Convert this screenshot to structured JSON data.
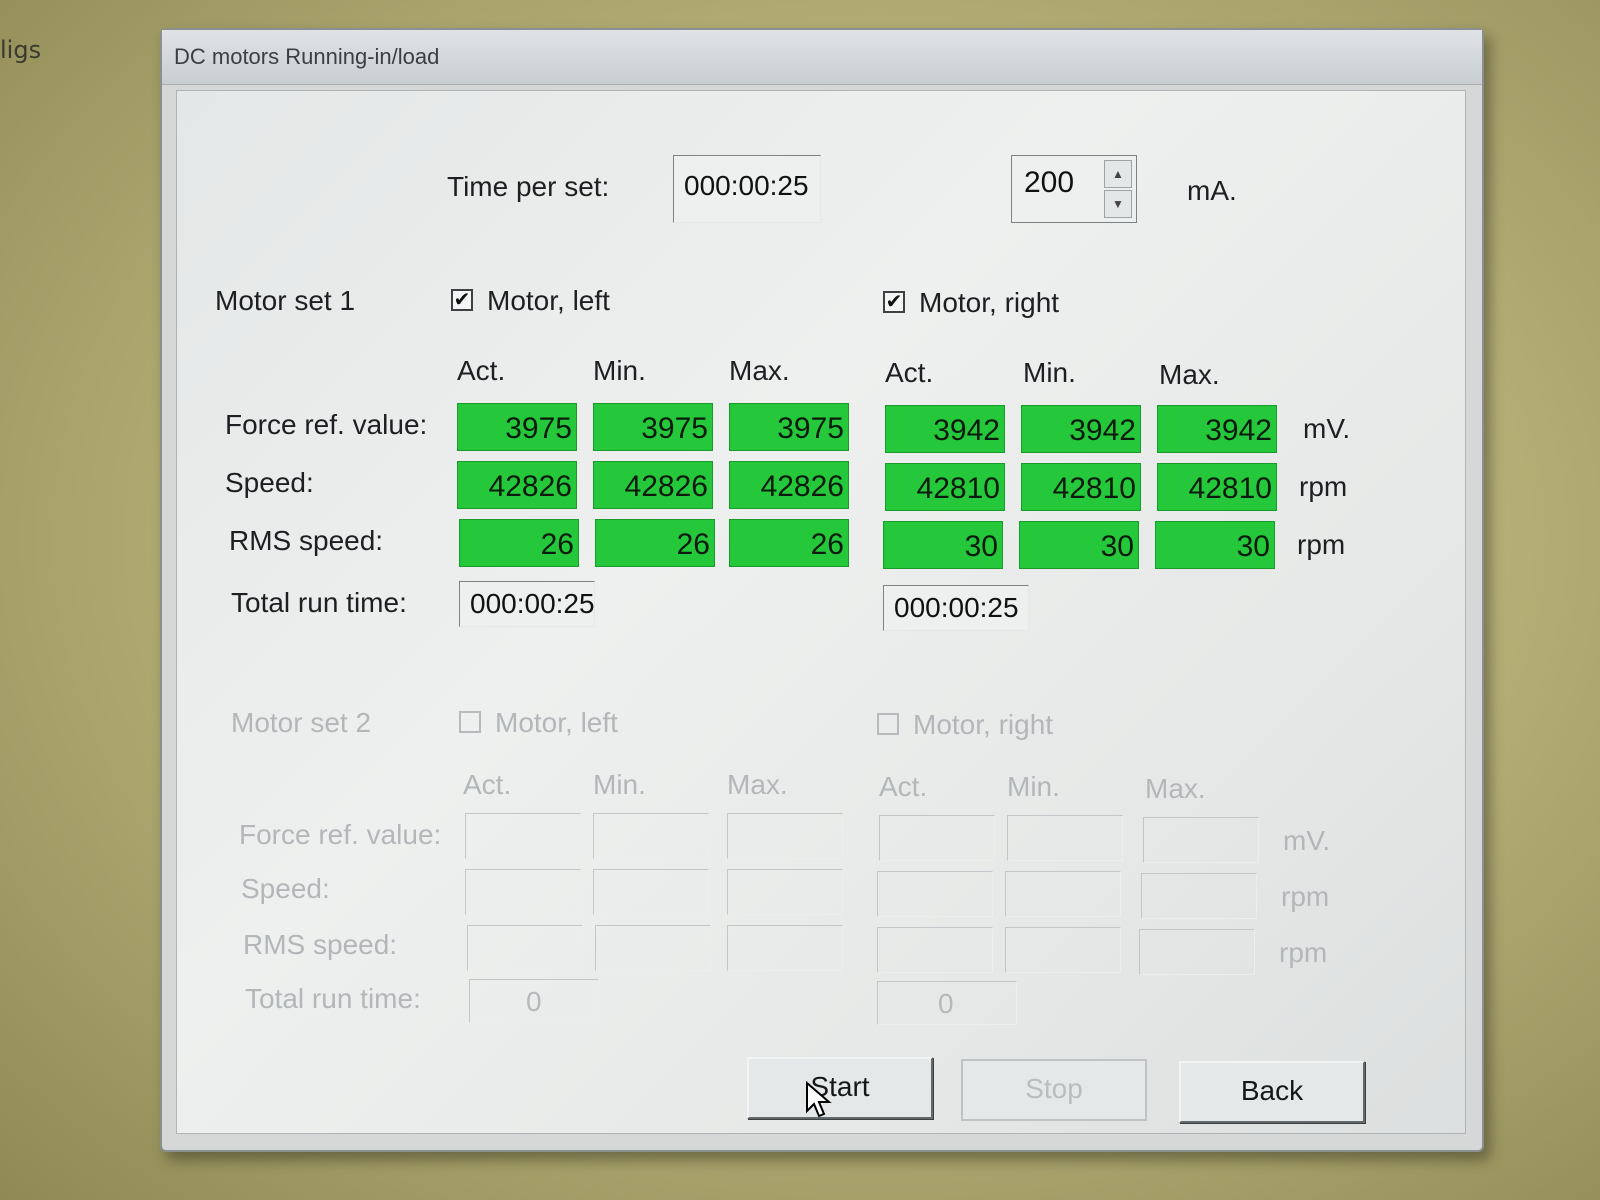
{
  "background": {
    "edge_text": "ligs"
  },
  "window": {
    "title": "DC motors Running-in/load"
  },
  "top": {
    "time_per_set_label": "Time per set:",
    "time_per_set_value": "000:00:25",
    "current_value": "200",
    "current_unit": "mA."
  },
  "columns": {
    "act": "Act.",
    "min": "Min.",
    "max": "Max."
  },
  "rows": {
    "force": "Force ref. value:",
    "speed": "Speed:",
    "rms": "RMS speed:",
    "total": "Total run time:"
  },
  "units": {
    "mv": "mV.",
    "rpm": "rpm"
  },
  "set1": {
    "label": "Motor set 1",
    "left_label": "Motor, left",
    "right_label": "Motor, right",
    "left_checked": true,
    "right_checked": true,
    "left": {
      "force": [
        "3975",
        "3975",
        "3975"
      ],
      "speed": [
        "42826",
        "42826",
        "42826"
      ],
      "rms": [
        "26",
        "26",
        "26"
      ],
      "total": "000:00:25"
    },
    "right": {
      "force": [
        "3942",
        "3942",
        "3942"
      ],
      "speed": [
        "42810",
        "42810",
        "42810"
      ],
      "rms": [
        "30",
        "30",
        "30"
      ],
      "total": "000:00:25"
    }
  },
  "set2": {
    "label": "Motor set 2",
    "left_label": "Motor, left",
    "right_label": "Motor, right",
    "left_checked": false,
    "right_checked": false,
    "left_total": "0",
    "right_total": "0"
  },
  "buttons": {
    "start": "Start",
    "stop": "Stop",
    "back": "Back"
  },
  "colors": {
    "value_ok": "#25c83a",
    "window_bg": "#e4e7e7"
  }
}
